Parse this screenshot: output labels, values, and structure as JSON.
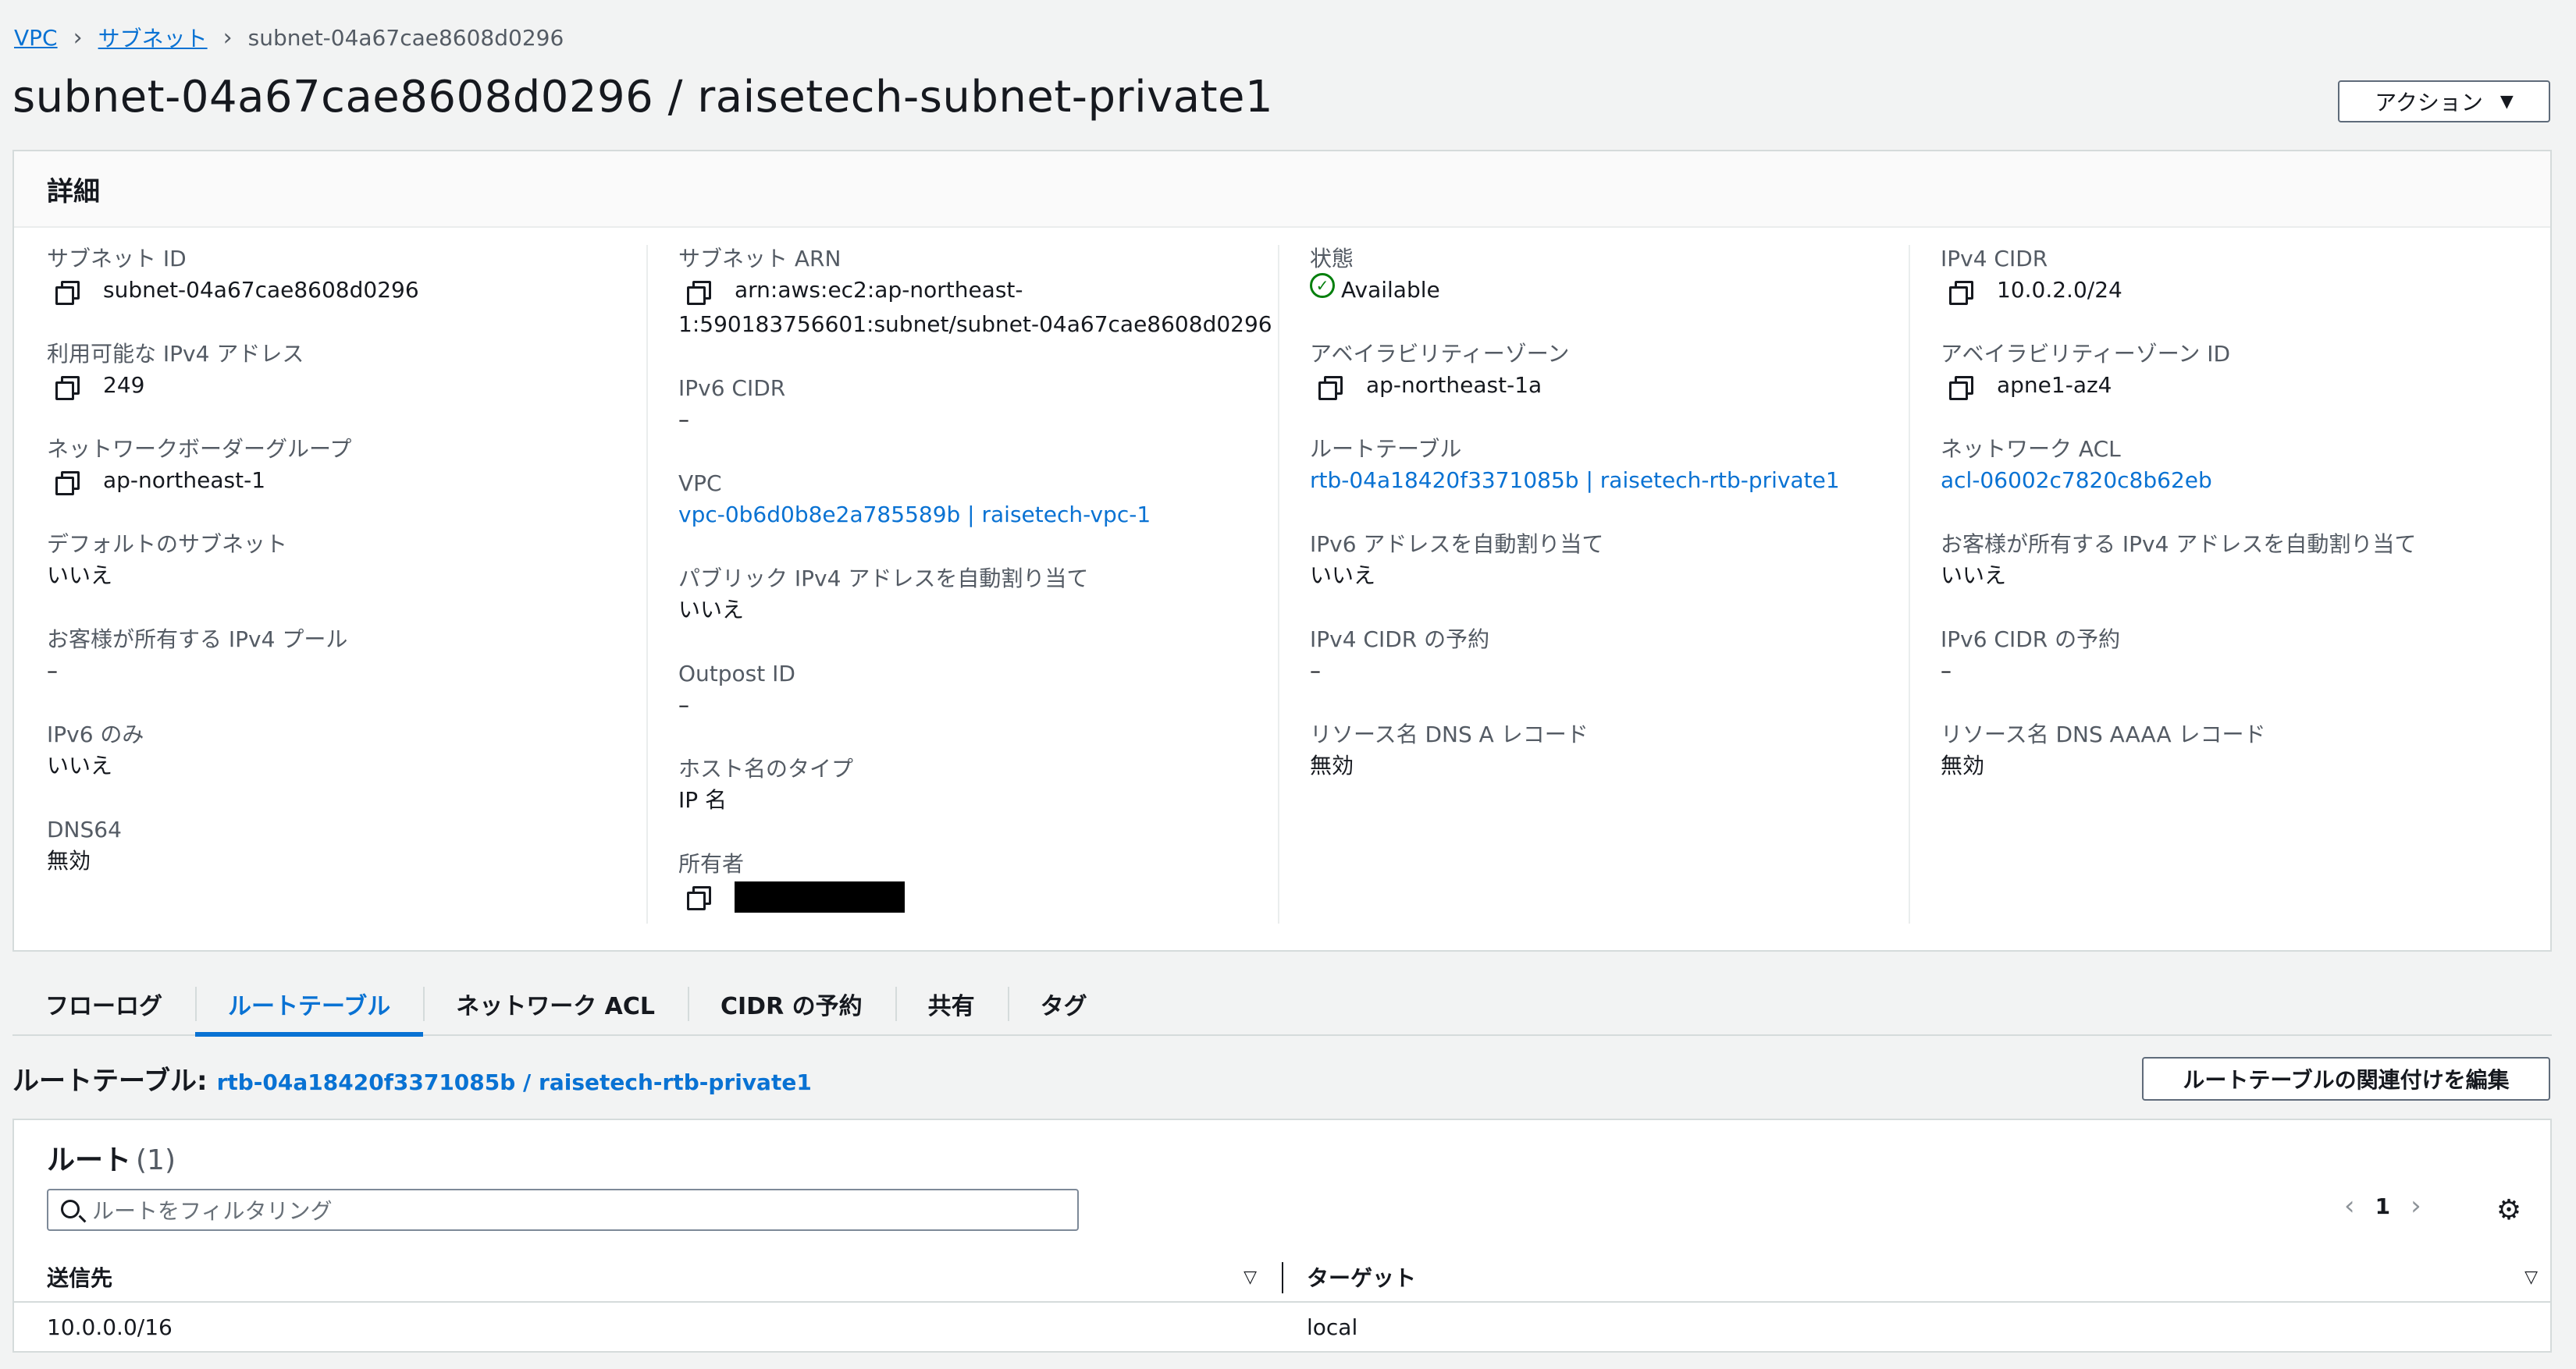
{
  "breadcrumb": {
    "root": "VPC",
    "section": "サブネット",
    "current": "subnet-04a67cae8608d0296"
  },
  "page_title": "subnet-04a67cae8608d0296 / raisetech-subnet-private1",
  "actions_label": "アクション",
  "details": {
    "header": "詳細",
    "col1": [
      {
        "label": "サブネット ID",
        "value": "subnet-04a67cae8608d0296"
      },
      {
        "label": "利用可能な IPv4 アドレス",
        "value": "249"
      },
      {
        "label": "ネットワークボーダーグループ",
        "value": "ap-northeast-1"
      },
      {
        "label": "デフォルトのサブネット",
        "value": "いいえ"
      },
      {
        "label": "お客様が所有する IPv4 プール",
        "value": "–"
      },
      {
        "label": "IPv6 のみ",
        "value": "いいえ"
      },
      {
        "label": "DNS64",
        "value": "無効"
      }
    ],
    "col2": [
      {
        "label": "サブネット ARN",
        "value_line1": "arn:aws:ec2:ap-northeast-",
        "value_line2": "1:590183756601:subnet/subnet-04a67cae8608d0296"
      },
      {
        "label": "IPv6 CIDR",
        "value": "–"
      },
      {
        "label": "VPC",
        "value": "vpc-0b6d0b8e2a785589b | raisetech-vpc-1"
      },
      {
        "label": "パブリック IPv4 アドレスを自動割り当て",
        "value": "いいえ"
      },
      {
        "label": "Outpost ID",
        "value": "–"
      },
      {
        "label": "ホスト名のタイプ",
        "value": "IP 名"
      },
      {
        "label": "所有者",
        "value": ""
      }
    ],
    "col3": [
      {
        "label": "状態",
        "value": "Available"
      },
      {
        "label": "アベイラビリティーゾーン",
        "value": "ap-northeast-1a"
      },
      {
        "label": "ルートテーブル",
        "value": "rtb-04a18420f3371085b | raisetech-rtb-private1"
      },
      {
        "label": "IPv6 アドレスを自動割り当て",
        "value": "いいえ"
      },
      {
        "label": "IPv4 CIDR の予約",
        "value": "–"
      },
      {
        "label": "リソース名 DNS A レコード",
        "value": "無効"
      }
    ],
    "col4": [
      {
        "label": "IPv4 CIDR",
        "value": "10.0.2.0/24"
      },
      {
        "label": "アベイラビリティーゾーン ID",
        "value": "apne1-az4"
      },
      {
        "label": "ネットワーク ACL",
        "value": "acl-06002c7820c8b62eb"
      },
      {
        "label": "お客様が所有する IPv4 アドレスを自動割り当て",
        "value": "いいえ"
      },
      {
        "label": "IPv6 CIDR の予約",
        "value": "–"
      },
      {
        "label": "リソース名 DNS AAAA レコード",
        "value": "無効"
      }
    ]
  },
  "tabs": [
    "フローログ",
    "ルートテーブル",
    "ネットワーク ACL",
    "CIDR の予約",
    "共有",
    "タグ"
  ],
  "active_tab": "ルートテーブル",
  "route_table": {
    "label": "ルートテーブル:",
    "link": "rtb-04a18420f3371085b / raisetech-rtb-private1",
    "edit_button": "ルートテーブルの関連付けを編集"
  },
  "routes": {
    "title": "ルート",
    "count": "(1)",
    "filter_placeholder": "ルートをフィルタリング",
    "page": "1",
    "columns": [
      "送信先",
      "ターゲット"
    ],
    "rows": [
      {
        "destination": "10.0.0.0/16",
        "target": "local"
      }
    ]
  },
  "colors": {
    "link": "#0972d3",
    "success": "#037f0c",
    "text": "#16191f",
    "muted": "#545b64"
  },
  "icons": [
    "copy-icon",
    "status-check-icon",
    "search-icon",
    "chevron-left-icon",
    "chevron-right-icon",
    "gear-icon",
    "sort-caret-icon"
  ]
}
